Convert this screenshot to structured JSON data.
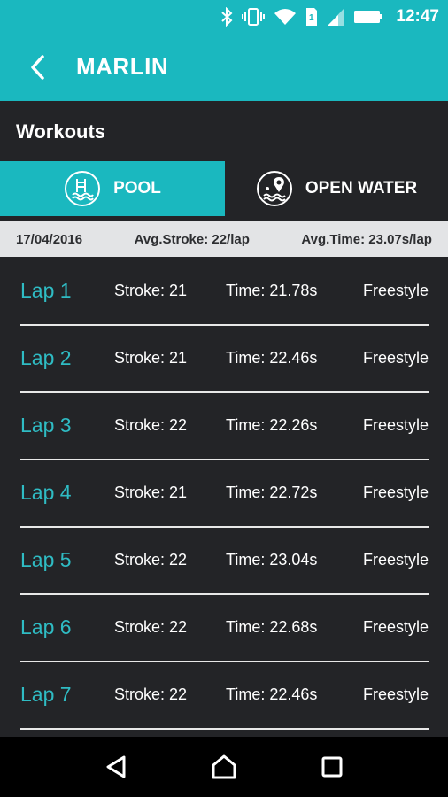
{
  "status_bar": {
    "time": "12:47",
    "icons": [
      "bluetooth-icon",
      "vibrate-icon",
      "wifi-icon",
      "sim-icon",
      "signal-icon",
      "battery-icon"
    ]
  },
  "app_bar": {
    "title": "MARLIN",
    "back_icon": "chevron-left-icon"
  },
  "section": {
    "title": "Workouts"
  },
  "tabs": [
    {
      "label": "POOL",
      "icon": "pool-icon",
      "active": true
    },
    {
      "label": "OPEN WATER",
      "icon": "open-water-location-icon",
      "active": false
    }
  ],
  "summary": {
    "date": "17/04/2016",
    "avg_stroke": "Avg.Stroke: 22/lap",
    "avg_time": "Avg.Time: 23.07s/lap"
  },
  "laps": [
    {
      "label": "Lap 1",
      "stroke": "Stroke: 21",
      "time": "Time: 21.78s",
      "style": "Freestyle"
    },
    {
      "label": "Lap 2",
      "stroke": "Stroke: 21",
      "time": "Time: 22.46s",
      "style": "Freestyle"
    },
    {
      "label": "Lap 3",
      "stroke": "Stroke: 22",
      "time": "Time: 22.26s",
      "style": "Freestyle"
    },
    {
      "label": "Lap 4",
      "stroke": "Stroke: 21",
      "time": "Time: 22.72s",
      "style": "Freestyle"
    },
    {
      "label": "Lap 5",
      "stroke": "Stroke: 22",
      "time": "Time: 23.04s",
      "style": "Freestyle"
    },
    {
      "label": "Lap 6",
      "stroke": "Stroke: 22",
      "time": "Time: 22.68s",
      "style": "Freestyle"
    },
    {
      "label": "Lap 7",
      "stroke": "Stroke: 22",
      "time": "Time: 22.46s",
      "style": "Freestyle"
    }
  ],
  "nav_bar": {
    "buttons": [
      "back-nav-icon",
      "home-nav-icon",
      "recents-nav-icon"
    ]
  },
  "colors": {
    "accent": "#1ab8bf",
    "background": "#232427",
    "summary_bg": "#e3e4e6",
    "lap_label": "#2fbcc4"
  }
}
